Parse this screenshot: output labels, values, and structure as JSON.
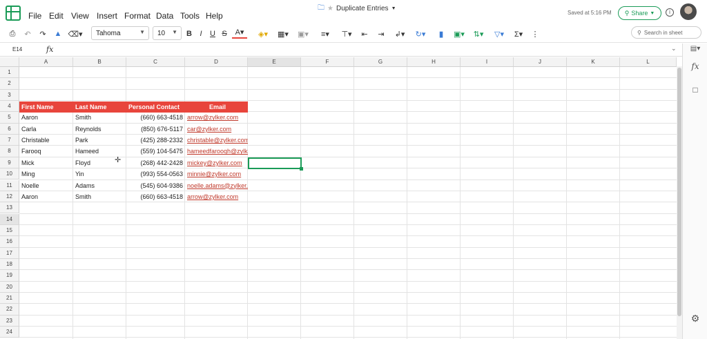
{
  "menu": [
    "File",
    "Edit",
    "View",
    "Insert",
    "Format",
    "Data",
    "Tools",
    "Help"
  ],
  "document": {
    "title": "Duplicate Entries",
    "saved": "Saved at 5:16 PM"
  },
  "share": {
    "label": "Share"
  },
  "toolbar": {
    "font": "Tahoma",
    "font_size": "10",
    "search_placeholder": "Search in sheet"
  },
  "formula_bar": {
    "cell_ref": "E14",
    "fx": "fx"
  },
  "columns": [
    "A",
    "B",
    "C",
    "D",
    "E",
    "F",
    "G",
    "H",
    "I",
    "J",
    "K",
    "L"
  ],
  "rows": [
    "1",
    "2",
    "3",
    "4",
    "5",
    "6",
    "7",
    "8",
    "9",
    "10",
    "11",
    "12",
    "13",
    "14",
    "15",
    "16",
    "17",
    "18",
    "19",
    "20",
    "21",
    "22",
    "23",
    "24"
  ],
  "table": {
    "headers": [
      "First Name",
      "Last Name",
      "Personal Contact",
      "Email"
    ],
    "rows": [
      [
        "Aaron",
        "Smith",
        "(660) 663-4518",
        "arrow@zylker.com"
      ],
      [
        "Carla",
        "Reynolds",
        "(850) 676-5117",
        "car@zylker.com"
      ],
      [
        "Christable",
        "Park",
        "(425) 288-2332",
        "christable@zylker.com"
      ],
      [
        "Farooq",
        "Hameed",
        "(559) 104-5475",
        "hameedfarooqh@zylker.com"
      ],
      [
        "Mick",
        "Floyd",
        "(268) 442-2428",
        "mickey@zylker.com"
      ],
      [
        "Ming",
        "Yin",
        "(993) 554-0563",
        "minnie@zylker.com"
      ],
      [
        "Noelle",
        "Adams",
        "(545) 604-9386",
        "noelle.adams@zylker.com"
      ],
      [
        "Aaron",
        "Smith",
        "(660) 663-4518",
        "arrow@zylker.com"
      ]
    ]
  },
  "colors": {
    "accent": "#1a9b57",
    "header_fill": "#e8453c",
    "link": "#c0392b"
  }
}
